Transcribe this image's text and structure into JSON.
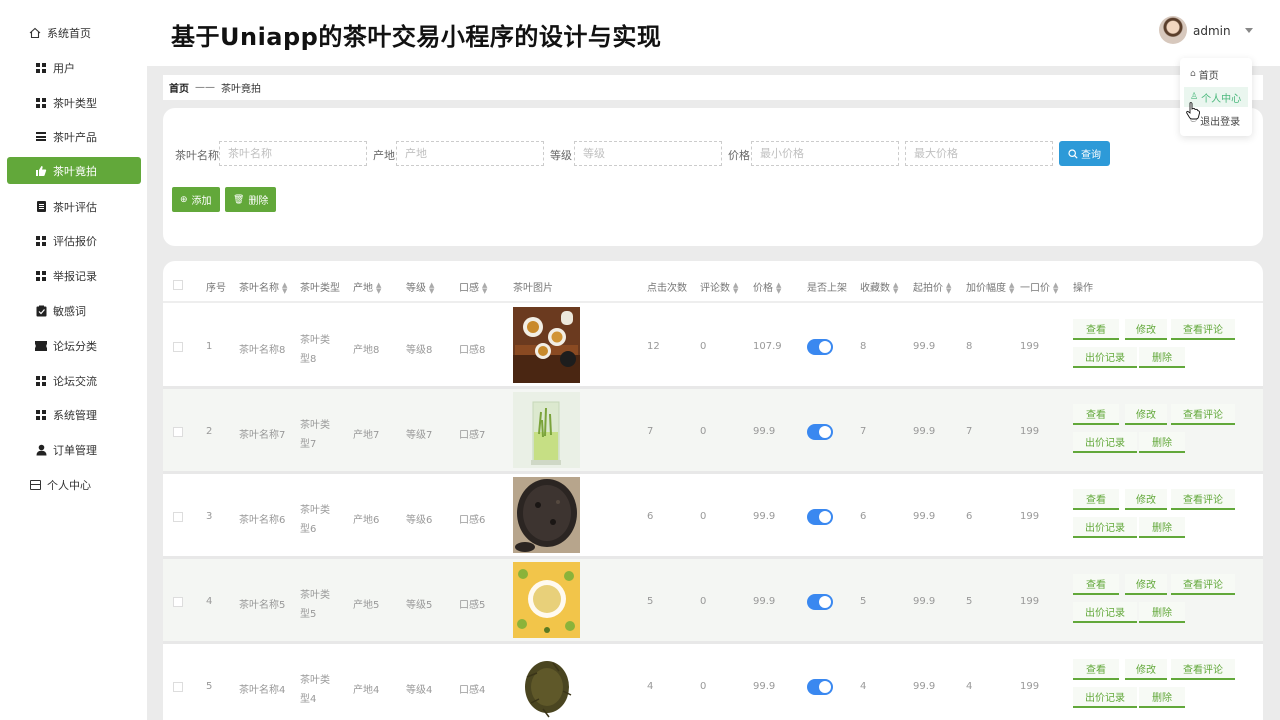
{
  "title": "基于Uniapp的茶叶交易小程序的设计与实现",
  "user": {
    "name": "admin"
  },
  "dropdown": {
    "items": [
      {
        "label": "首页",
        "icon": "home-icon"
      },
      {
        "label": "个人中心",
        "icon": "user-icon"
      },
      {
        "label": "退出登录",
        "icon": "logout-icon"
      }
    ]
  },
  "sidebar": {
    "items": [
      {
        "label": "系统首页",
        "icon": "home-icon"
      },
      {
        "label": "用户",
        "icon": "grid-icon"
      },
      {
        "label": "茶叶类型",
        "icon": "grid-icon"
      },
      {
        "label": "茶叶产品",
        "icon": "list-icon"
      },
      {
        "label": "茶叶竟拍",
        "icon": "thumb-icon",
        "active": true
      },
      {
        "label": "茶叶评估",
        "icon": "document-icon"
      },
      {
        "label": "评估报价",
        "icon": "grid-icon"
      },
      {
        "label": "举报记录",
        "icon": "grid-icon"
      },
      {
        "label": "敏感词",
        "icon": "clipboard-icon"
      },
      {
        "label": "论坛分类",
        "icon": "ticket-icon"
      },
      {
        "label": "论坛交流",
        "icon": "grid-icon"
      },
      {
        "label": "系统管理",
        "icon": "grid-icon"
      },
      {
        "label": "订单管理",
        "icon": "person-icon"
      },
      {
        "label": "个人中心",
        "icon": "panel-icon"
      }
    ]
  },
  "breadcrumb": {
    "home": "首页",
    "sep": "——",
    "current": "茶叶竟拍"
  },
  "search": {
    "name_label": "茶叶名称",
    "name_placeholder": "茶叶名称",
    "origin_label": "产地",
    "origin_placeholder": "产地",
    "grade_label": "等级",
    "grade_placeholder": "等级",
    "price_label": "价格",
    "min_placeholder": "最小价格",
    "max_placeholder": "最大价格",
    "query_label": "查询",
    "add_label": "添加",
    "delete_label": "删除"
  },
  "table": {
    "headers": {
      "index": "序号",
      "name": "茶叶名称",
      "type": "茶叶类型",
      "origin": "产地",
      "grade": "等级",
      "taste": "口感",
      "image": "茶叶图片",
      "clicks": "点击次数",
      "comments": "评论数",
      "price": "价格",
      "listed": "是否上架",
      "favorites": "收藏数",
      "start_price": "起拍价",
      "increment": "加价幅度",
      "buyout": "一口价",
      "ops": "操作"
    },
    "actions": {
      "view": "查看",
      "edit": "修改",
      "view_comments": "查看评论",
      "bid_records": "出价记录",
      "delete": "删除"
    },
    "rows": [
      {
        "index": "1",
        "name": "茶叶名称8",
        "type1": "茶叶类",
        "type2": "型8",
        "origin": "产地8",
        "grade": "等级8",
        "taste": "口感8",
        "clicks": "12",
        "comments": "0",
        "price": "107.9",
        "listed": true,
        "favorites": "8",
        "start_price": "99.9",
        "increment": "8",
        "buyout": "199"
      },
      {
        "index": "2",
        "name": "茶叶名称7",
        "type1": "茶叶类",
        "type2": "型7",
        "origin": "产地7",
        "grade": "等级7",
        "taste": "口感7",
        "clicks": "7",
        "comments": "0",
        "price": "99.9",
        "listed": true,
        "favorites": "7",
        "start_price": "99.9",
        "increment": "7",
        "buyout": "199"
      },
      {
        "index": "3",
        "name": "茶叶名称6",
        "type1": "茶叶类",
        "type2": "型6",
        "origin": "产地6",
        "grade": "等级6",
        "taste": "口感6",
        "clicks": "6",
        "comments": "0",
        "price": "99.9",
        "listed": true,
        "favorites": "6",
        "start_price": "99.9",
        "increment": "6",
        "buyout": "199"
      },
      {
        "index": "4",
        "name": "茶叶名称5",
        "type1": "茶叶类",
        "type2": "型5",
        "origin": "产地5",
        "grade": "等级5",
        "taste": "口感5",
        "clicks": "5",
        "comments": "0",
        "price": "99.9",
        "listed": true,
        "favorites": "5",
        "start_price": "99.9",
        "increment": "5",
        "buyout": "199"
      },
      {
        "index": "5",
        "name": "茶叶名称4",
        "type1": "茶叶类",
        "type2": "型4",
        "origin": "产地4",
        "grade": "等级4",
        "taste": "口感4",
        "clicks": "4",
        "comments": "0",
        "price": "99.9",
        "listed": true,
        "favorites": "4",
        "start_price": "99.9",
        "increment": "4",
        "buyout": "199"
      }
    ]
  },
  "colors": {
    "accent": "#62a83a",
    "query": "#2d9ad8",
    "toggle": "#3a88f0",
    "dropdown_hover": "#4bb87c"
  }
}
